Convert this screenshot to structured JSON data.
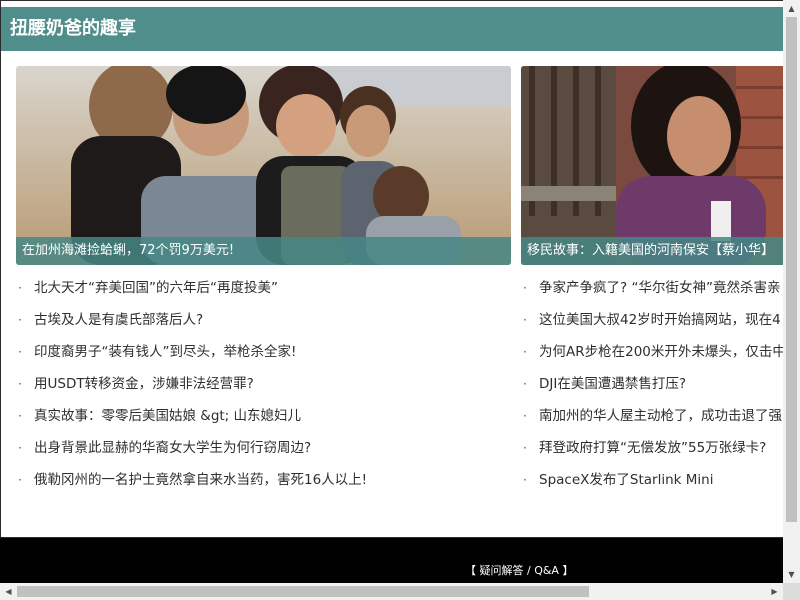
{
  "header": {
    "title": "扭腰奶爸的趣享",
    "background": "#508e8c"
  },
  "featured": [
    {
      "caption": "在加州海滩捡蛤蜊，72个罚9万美元!"
    },
    {
      "caption": "移民故事：入籍美国的河南保安【蔡小华】"
    }
  ],
  "list_left": [
    "北大天才“弃美回国”的六年后“再度投美”",
    "古埃及人是有虞氏部落后人?",
    "印度裔男子“装有钱人”到尽头，举枪杀全家!",
    "用USDT转移资金，涉嫌非法经营罪?",
    "真实故事：零零后美国姑娘 &gt; 山东媳妇儿",
    "出身背景此显赫的华裔女大学生为何行窃周边?",
    "俄勒冈州的一名护士竟然拿自来水当药，害死16人以上!"
  ],
  "list_right": [
    "争家产争疯了? “华尔街女神”竟然杀害亲",
    "这位美国大叔42岁时开始搞网站，现在4",
    "为何AR步枪在200米开外未爆头，仅击中",
    "DJI在美国遭遇禁售打压?",
    "南加州的华人屋主动枪了，成功击退了强",
    "拜登政府打算“无偿发放”55万张绿卡?",
    "SpaceX发布了Starlink Mini"
  ],
  "bullet": "·",
  "footer": {
    "link": "【 疑问解答 / Q&A 】"
  }
}
